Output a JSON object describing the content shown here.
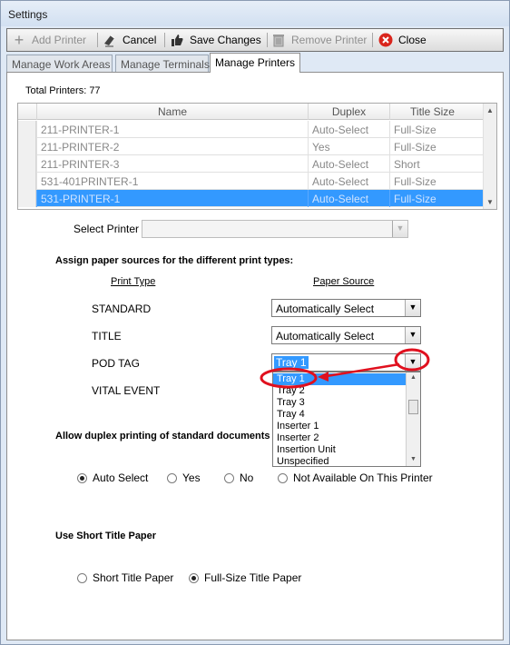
{
  "window": {
    "title": "Settings"
  },
  "toolbar": {
    "add_printer": "Add Printer",
    "cancel": "Cancel",
    "save_changes": "Save Changes",
    "remove_printer": "Remove Printer",
    "close": "Close"
  },
  "tabs": [
    "Manage Work Areas",
    "Manage Terminals",
    "Manage Printers"
  ],
  "printers": {
    "total_label": "Total Printers:",
    "total_value": "77",
    "columns": [
      "Name",
      "Duplex",
      "Title Size"
    ],
    "rows": [
      {
        "name": "211-PRINTER-1",
        "duplex": "Auto-Select",
        "title_size": "Full-Size"
      },
      {
        "name": "211-PRINTER-2",
        "duplex": "Yes",
        "title_size": "Full-Size"
      },
      {
        "name": "211-PRINTER-3",
        "duplex": "Auto-Select",
        "title_size": "Short"
      },
      {
        "name": "531-401PRINTER-1",
        "duplex": "Auto-Select",
        "title_size": "Full-Size"
      },
      {
        "name": "531-PRINTER-1",
        "duplex": "Auto-Select",
        "title_size": "Full-Size"
      }
    ],
    "select_label": "Select Printer",
    "select_value": ""
  },
  "paper_sources": {
    "heading": "Assign paper sources for the different print types:",
    "col_print_type": "Print Type",
    "col_paper_source": "Paper Source",
    "rows": [
      {
        "type": "STANDARD",
        "source": "Automatically Select"
      },
      {
        "type": "TITLE",
        "source": "Automatically Select"
      },
      {
        "type": "POD TAG",
        "source": "Tray 1"
      },
      {
        "type": "VITAL EVENT",
        "source": ""
      }
    ],
    "dropdown_options": [
      "Tray 1",
      "Tray 2",
      "Tray 3",
      "Tray 4",
      "Inserter 1",
      "Inserter 2",
      "Insertion Unit",
      "Unspecified"
    ]
  },
  "duplex": {
    "heading": "Allow duplex printing of standard documents",
    "options": [
      "Auto Select",
      "Yes",
      "No",
      "Not Available On This Printer"
    ],
    "selected": "Auto Select"
  },
  "short_title": {
    "heading": "Use Short Title Paper",
    "options": [
      "Short Title Paper",
      "Full-Size Title Paper"
    ],
    "selected": "Full-Size Title Paper"
  },
  "annotation_color": "#e0101e",
  "selection_color": "#3399ff"
}
